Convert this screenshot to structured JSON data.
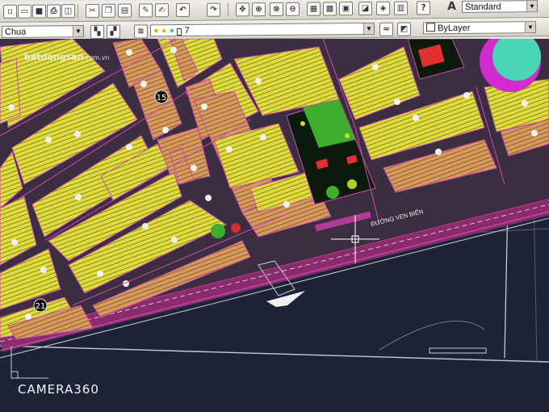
{
  "toolbar": {
    "style_combo": "Standard",
    "layer_combo": "Chua",
    "layer_number": "7",
    "linetype_combo": "ByLayer"
  },
  "drawing": {
    "road_label": "ĐƯỜNG VEN BIỂN",
    "lot_numbers": [
      "15",
      "21"
    ]
  },
  "watermark": {
    "site": "batdongsan",
    "site_suffix": ".com.vn",
    "camera": "CAMERA360"
  },
  "icons": [
    "new-icon",
    "open-icon",
    "save-icon",
    "print-icon",
    "preview-icon",
    "cut-icon",
    "copy-icon",
    "paste-icon",
    "match-prop-icon",
    "undo-icon",
    "redo-icon",
    "pan-icon",
    "zoom-icon",
    "zoom-window-icon",
    "properties-icon",
    "design-center-icon",
    "tool-palette-icon",
    "markup-icon",
    "calculator-icon",
    "help-icon",
    "text-style-icon",
    "layer-manager-icon",
    "layer-state-icon",
    "color-icon"
  ]
}
